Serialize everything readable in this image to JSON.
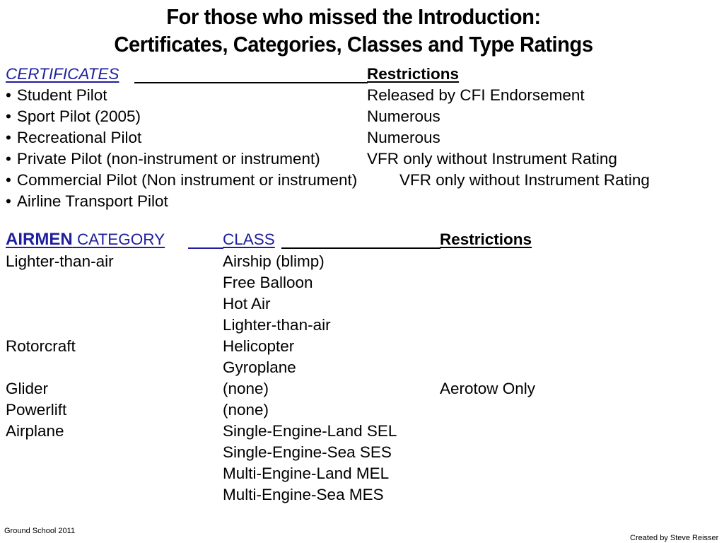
{
  "title": {
    "line1": "For those who missed the Introduction:",
    "line2": "Certificates, Categories, Classes and Type Ratings"
  },
  "certificates": {
    "heading": "CERTIFICATES",
    "restrictions_heading": "Restrictions",
    "bullet": "•",
    "items": [
      {
        "name": "Student Pilot",
        "restriction": "Released by CFI Endorsement"
      },
      {
        "name": "Sport Pilot (2005)",
        "restriction": "Numerous"
      },
      {
        "name": "Recreational Pilot",
        "restriction": "Numerous"
      },
      {
        "name": "Private Pilot (non-instrument or instrument)",
        "restriction": "VFR only without Instrument Rating"
      },
      {
        "name": "Commercial Pilot (Non instrument or instrument)",
        "restriction": "VFR only without Instrument Rating"
      },
      {
        "name": "Airline Transport Pilot",
        "restriction": ""
      }
    ]
  },
  "categories": {
    "heading_airmen": "AIRMEN",
    "heading_category": "CATEGORY",
    "heading_class": "CLASS",
    "heading_restrictions": "Restrictions",
    "rows": [
      {
        "category": "Lighter-than-air",
        "class": "Airship (blimp)",
        "restriction": ""
      },
      {
        "category": "",
        "class": "Free Balloon",
        "restriction": ""
      },
      {
        "category": "",
        "class": "Hot Air",
        "restriction": ""
      },
      {
        "category": "",
        "class": "Lighter-than-air",
        "restriction": ""
      },
      {
        "category": "Rotorcraft",
        "class": "Helicopter",
        "restriction": ""
      },
      {
        "category": "",
        "class": "Gyroplane",
        "restriction": ""
      },
      {
        "category": "Glider",
        "class": "(none)",
        "restriction": "Aerotow Only"
      },
      {
        "category": "Powerlift",
        "class": "(none)",
        "restriction": ""
      },
      {
        "category": "Airplane",
        "class": "Single-Engine-Land SEL",
        "restriction": ""
      },
      {
        "category": "",
        "class": "Single-Engine-Sea SES",
        "restriction": ""
      },
      {
        "category": "",
        "class": "Multi-Engine-Land MEL",
        "restriction": ""
      },
      {
        "category": "",
        "class": "Multi-Engine-Sea MES",
        "restriction": ""
      }
    ]
  },
  "footer": {
    "left": "Ground School 2011",
    "right": "Created by Steve Reisser"
  },
  "colors": {
    "heading_blue": "#1f1f9e",
    "text": "#000000",
    "background": "#ffffff"
  }
}
